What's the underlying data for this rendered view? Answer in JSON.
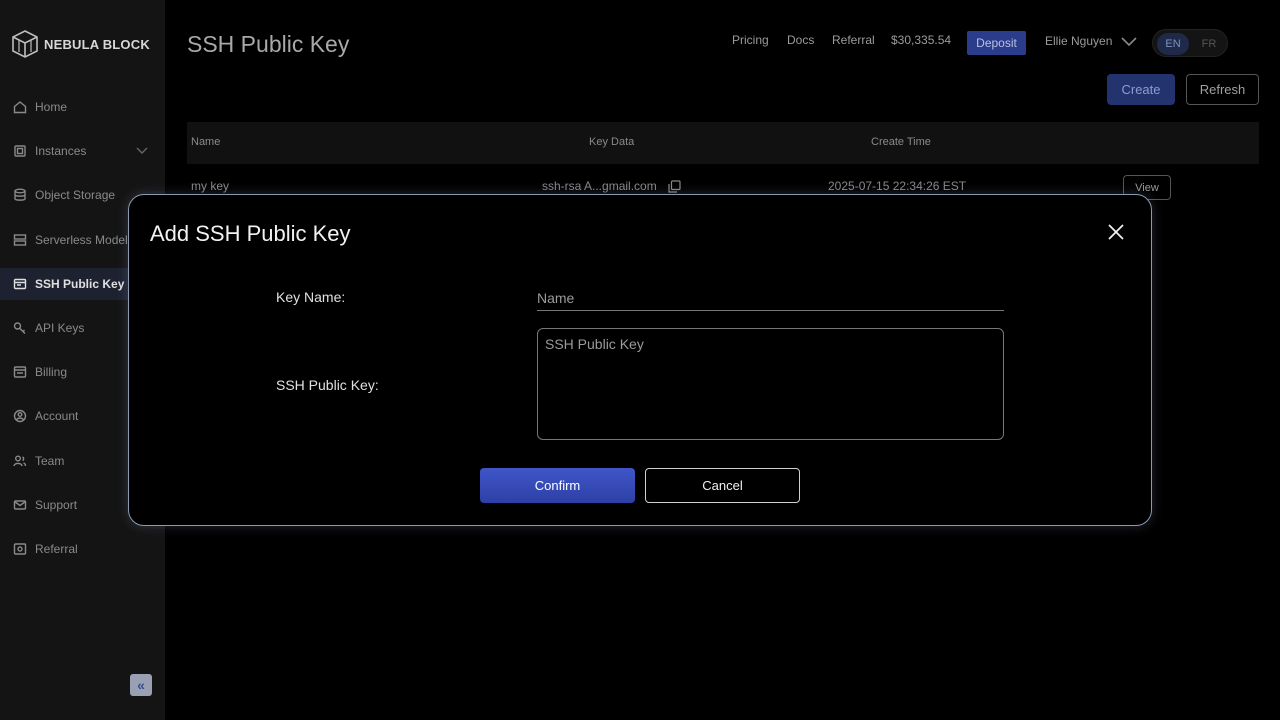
{
  "brand": {
    "name": "NEBULA BLOCK"
  },
  "sidebar": {
    "items": [
      {
        "label": "Home",
        "icon": "home-icon"
      },
      {
        "label": "Instances",
        "icon": "instances-icon"
      },
      {
        "label": "Object Storage",
        "icon": "database-icon"
      },
      {
        "label": "Serverless Models",
        "icon": "server-icon"
      },
      {
        "label": "SSH Public Key",
        "icon": "ssh-key-icon",
        "active": true
      },
      {
        "label": "API Keys",
        "icon": "key-icon"
      },
      {
        "label": "Billing",
        "icon": "billing-icon"
      },
      {
        "label": "Account",
        "icon": "account-icon"
      },
      {
        "label": "Team",
        "icon": "team-icon"
      },
      {
        "label": "Support",
        "icon": "mail-icon"
      },
      {
        "label": "Referral",
        "icon": "referral-icon"
      }
    ],
    "collapse_glyph": "«"
  },
  "header": {
    "title": "SSH Public Key",
    "nav": {
      "pricing": "Pricing",
      "docs": "Docs",
      "referral": "Referral"
    },
    "balance": "$30,335.54",
    "deposit": "Deposit",
    "user": "Ellie Nguyen",
    "lang": {
      "en": "EN",
      "fr": "FR"
    }
  },
  "toolbar": {
    "create": "Create",
    "refresh": "Refresh"
  },
  "table": {
    "columns": [
      "Name",
      "Key Data",
      "Create Time"
    ],
    "rows": [
      {
        "name": "my key",
        "key_data": "ssh-rsa A...gmail.com",
        "create_time": "2025-07-15 22:34:26 EST",
        "action": "View"
      }
    ]
  },
  "modal": {
    "title": "Add SSH Public Key",
    "key_name_label": "Key Name:",
    "key_name_placeholder": "Name",
    "ssh_key_label": "SSH Public Key:",
    "ssh_key_placeholder": "SSH Public Key",
    "confirm": "Confirm",
    "cancel": "Cancel"
  },
  "colors": {
    "accent": "#3f56c8",
    "background": "#000000",
    "sidebar": "#141414"
  }
}
